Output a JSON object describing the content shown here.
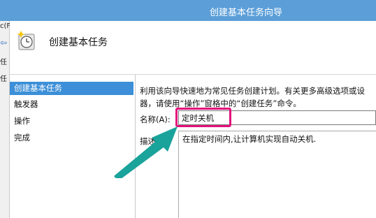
{
  "window": {
    "title": "创建基本任务向导"
  },
  "parent_window": {
    "fragments": [
      "c(F",
      "⇦",
      "任",
      "任"
    ]
  },
  "header": {
    "title": "创建基本任务",
    "icon": "clock-icon"
  },
  "nav": {
    "items": [
      {
        "label": "创建基本任务",
        "selected": true
      },
      {
        "label": "触发器",
        "selected": false
      },
      {
        "label": "操作",
        "selected": false
      },
      {
        "label": "完成",
        "selected": false
      }
    ]
  },
  "content": {
    "description_lines": [
      "利用该向导快速地为常见任务创建计划。有关更多高级选项或设",
      "器，请使用“操作”窗格中的“创建任务”命令。"
    ],
    "name_label": "名称(A):",
    "name_value": "定时关机",
    "desc_label": "描述(D):",
    "desc_value": "在指定时间内,让计算机实现自动关机."
  },
  "annotation": {
    "highlight_color": "#e3127b",
    "arrow_color": "#1aa39a"
  },
  "colors": {
    "titlebar": "#5b9ed8",
    "nav_selected": "#3c8fd8"
  }
}
